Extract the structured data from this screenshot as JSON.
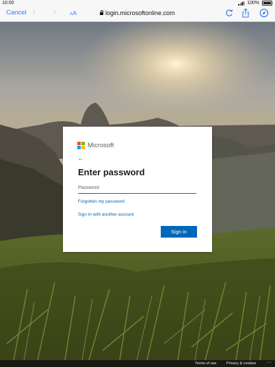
{
  "status_bar": {
    "time": "10:00",
    "battery": "100%"
  },
  "browser": {
    "cancel_label": "Cancel",
    "text_size_label_small": "A",
    "text_size_label_large": "A",
    "url": "login.microsoftonline.com",
    "icons": [
      "back-icon",
      "forward-icon",
      "reload-icon",
      "share-icon",
      "compass-icon",
      "lock-icon"
    ]
  },
  "card": {
    "brand": "Microsoft",
    "back_glyph": "←",
    "title": "Enter password",
    "password_placeholder": "Password",
    "forgot_link": "Forgotten my password",
    "other_account_link": "Sign in with another account",
    "signin_button": "Sign in"
  },
  "footer": {
    "terms": "Terms of use",
    "privacy": "Privacy & cookies",
    "more": "···"
  },
  "colors": {
    "accent": "#0067b8",
    "safari_blue": "#2f7cf6",
    "ms_red": "#f25022",
    "ms_green": "#7fba00",
    "ms_blue": "#00a4ef",
    "ms_yellow": "#ffb900"
  }
}
